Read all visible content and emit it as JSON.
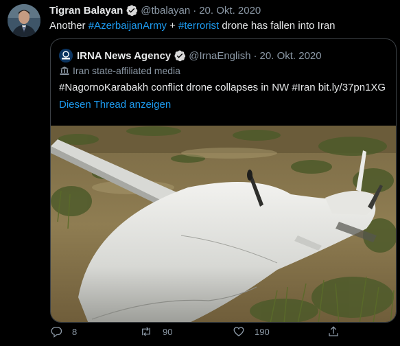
{
  "tweet": {
    "author_name": "Tigran Balayan",
    "handle": "@tbalayan",
    "separator": "·",
    "date": "20. Okt. 2020",
    "text_parts": {
      "t1": "Another ",
      "h1": "#AzerbaijanArmy",
      "t2": " + ",
      "h2": "#terrorist",
      "t3": " drone has fallen into Iran"
    }
  },
  "quoted": {
    "author_name": "IRNA News Agency",
    "handle": "@IrnaEnglish",
    "separator": "·",
    "date": "20. Okt. 2020",
    "label": "Iran state-affiliated media",
    "text": "#NagornoKarabakh conflict drone collapses in NW #Iran bit.ly/37pn1XG",
    "thread_link": "Diesen Thread anzeigen",
    "avatar_text": "IRNA"
  },
  "actions": {
    "replies": "8",
    "retweets": "90",
    "likes": "190"
  },
  "colors": {
    "background": "#000000",
    "link": "#1d9bf0",
    "muted": "#8b98a5",
    "verified": "#d9d9d9"
  }
}
